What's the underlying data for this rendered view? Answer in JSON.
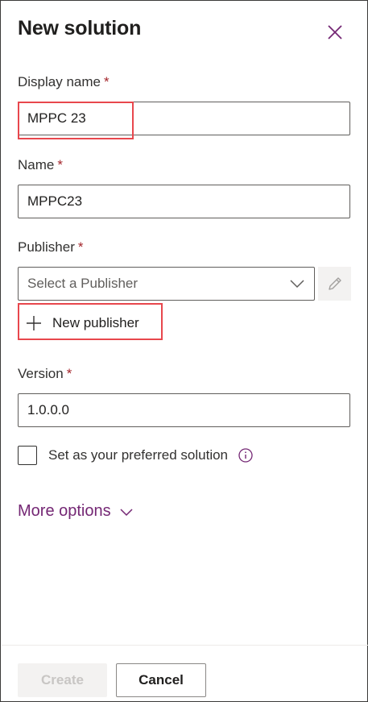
{
  "panel": {
    "title": "New solution"
  },
  "fields": {
    "display_name": {
      "label": "Display name",
      "required": "*",
      "value": "MPPC 23"
    },
    "name": {
      "label": "Name",
      "required": "*",
      "value": "MPPC23"
    },
    "publisher": {
      "label": "Publisher",
      "required": "*",
      "placeholder": "Select a Publisher",
      "new_label": "New publisher"
    },
    "version": {
      "label": "Version",
      "required": "*",
      "value": "1.0.0.0"
    }
  },
  "preferred": {
    "label": "Set as your preferred solution"
  },
  "more_options": {
    "label": "More options"
  },
  "footer": {
    "create_label": "Create",
    "cancel_label": "Cancel"
  },
  "colors": {
    "accent": "#742774",
    "required": "#a4262c",
    "highlight": "#e8474d"
  },
  "icons": [
    "close-icon",
    "chevron-down-icon",
    "pencil-icon",
    "plus-icon",
    "info-icon"
  ]
}
